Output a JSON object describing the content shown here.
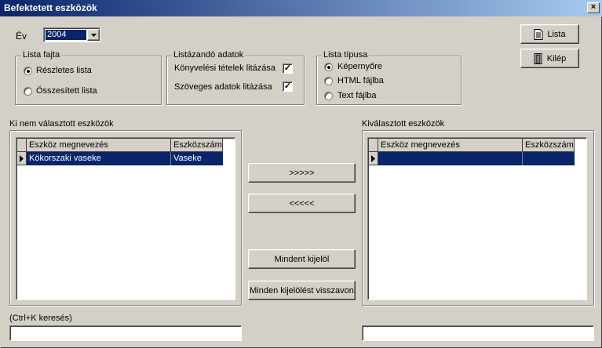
{
  "window": {
    "title": "Befektetett eszközök",
    "close_glyph": "×"
  },
  "year": {
    "label": "Év",
    "value": "2004"
  },
  "buttons": {
    "lista": "Lista",
    "kilep": "Kilép",
    "add": ">>>>>",
    "remove": "<<<<<",
    "select_all": "Mindent kijelöl",
    "clear_selection": "Minden kijelölést visszavon"
  },
  "list_type": {
    "label": "Lista fajta",
    "options": [
      "Részletes lista",
      "Összesített lista"
    ],
    "selected": 0
  },
  "listed_data": {
    "label": "Listázandó adatok",
    "options": [
      {
        "label": "Könyvelési tételek litázása",
        "checked": true
      },
      {
        "label": "Szöveges adatok litázása",
        "checked": true
      }
    ]
  },
  "output_type": {
    "label": "Lista típusa",
    "options": [
      "Képernyőre",
      "HTML fájlba",
      "Text fájlba"
    ],
    "selected": 0
  },
  "left_panel": {
    "label": "Ki nem választott eszközök",
    "columns": [
      "Eszköz megnevezés",
      "Eszközszám"
    ],
    "rows": [
      {
        "name": "Kökorszaki vaseke",
        "number": "Vaseke"
      }
    ],
    "search_label": "(Ctrl+K keresés)",
    "search_value": ""
  },
  "right_panel": {
    "label": "Kiválasztott eszközök",
    "columns": [
      "Eszköz megnevezés",
      "Eszközszám"
    ],
    "rows": [
      {
        "name": "",
        "number": ""
      }
    ],
    "search_value": ""
  }
}
